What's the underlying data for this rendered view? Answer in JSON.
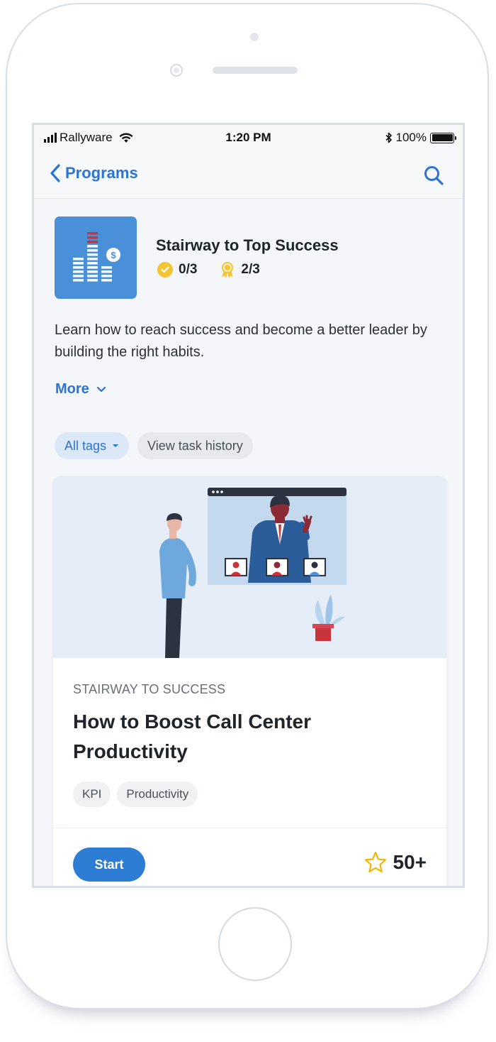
{
  "status_bar": {
    "carrier": "Rallyware",
    "time": "1:20 PM",
    "battery": "100%"
  },
  "nav": {
    "back_label": "Programs"
  },
  "program": {
    "title": "Stairway to Top Success",
    "completed": "0/3",
    "awards": "2/3",
    "description": "Learn how to reach success and become a better leader by building the right habits.",
    "more_label": "More"
  },
  "filters": {
    "tags_label": "All tags",
    "history_label": "View task history"
  },
  "card": {
    "kicker": "STAIRWAY TO SUCCESS",
    "title": "How to Boost Call Center Productivity",
    "tags": [
      "KPI",
      "Productivity"
    ],
    "start_label": "Start",
    "points": "50+"
  },
  "colors": {
    "accent": "#2b73d6",
    "button": "#2e7dd4",
    "program_icon_bg": "#4a90d9",
    "check": "#f5c431",
    "screen_bg": "#f4f6f9"
  },
  "icons": [
    "back-chevron-icon",
    "search-icon",
    "check-badge-icon",
    "award-ribbon-icon",
    "chevron-down-icon",
    "caret-down-icon",
    "star-icon",
    "wifi-icon",
    "bluetooth-icon",
    "battery-icon"
  ]
}
